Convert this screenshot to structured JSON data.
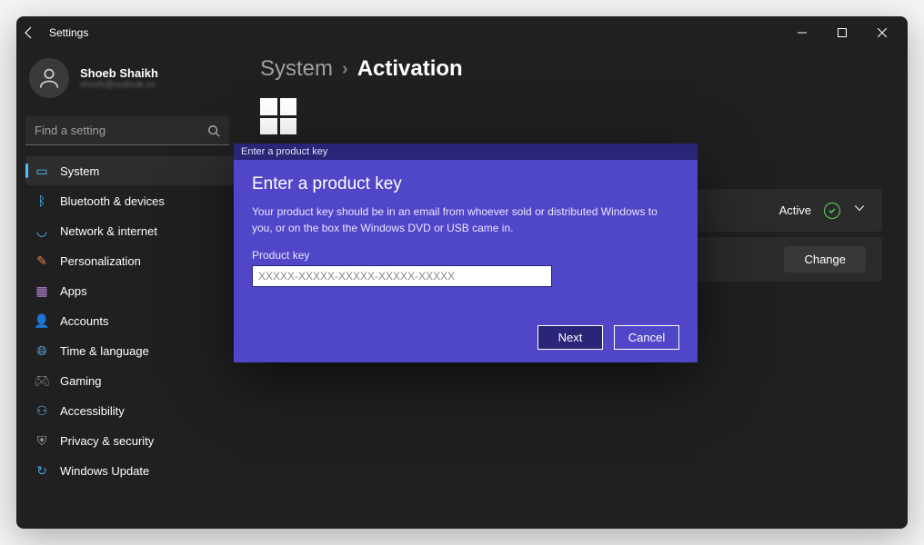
{
  "titlebar": {
    "title": "Settings"
  },
  "profile": {
    "name": "Shoeb Shaikh",
    "email": "shoeb@outlook.co"
  },
  "search": {
    "placeholder": "Find a setting"
  },
  "sidebar": {
    "items": [
      {
        "label": "System",
        "icon_color": "#4cc2ff",
        "active": true
      },
      {
        "label": "Bluetooth & devices",
        "icon_color": "#4cc2ff"
      },
      {
        "label": "Network & internet",
        "icon_color": "#4cc2ff"
      },
      {
        "label": "Personalization",
        "icon_color": "#e08050"
      },
      {
        "label": "Apps",
        "icon_color": "#b080d0"
      },
      {
        "label": "Accounts",
        "icon_color": "#40c090"
      },
      {
        "label": "Time & language",
        "icon_color": "#60b0e0"
      },
      {
        "label": "Gaming",
        "icon_color": "#888888"
      },
      {
        "label": "Accessibility",
        "icon_color": "#60b0e0"
      },
      {
        "label": "Privacy & security",
        "icon_color": "#a0a0a0"
      },
      {
        "label": "Windows Update",
        "icon_color": "#40a0e0"
      }
    ]
  },
  "breadcrumb": {
    "parent": "System",
    "current": "Activation"
  },
  "activation": {
    "status_label": "Active",
    "change_label": "Change"
  },
  "dialog": {
    "header": "Enter a product key",
    "title": "Enter a product key",
    "description": "Your product key should be in an email from whoever sold or distributed Windows to you, or on the box the Windows DVD or USB came in.",
    "input_label": "Product key",
    "input_placeholder": "XXXXX-XXXXX-XXXXX-XXXXX-XXXXX",
    "next_label": "Next",
    "cancel_label": "Cancel"
  }
}
